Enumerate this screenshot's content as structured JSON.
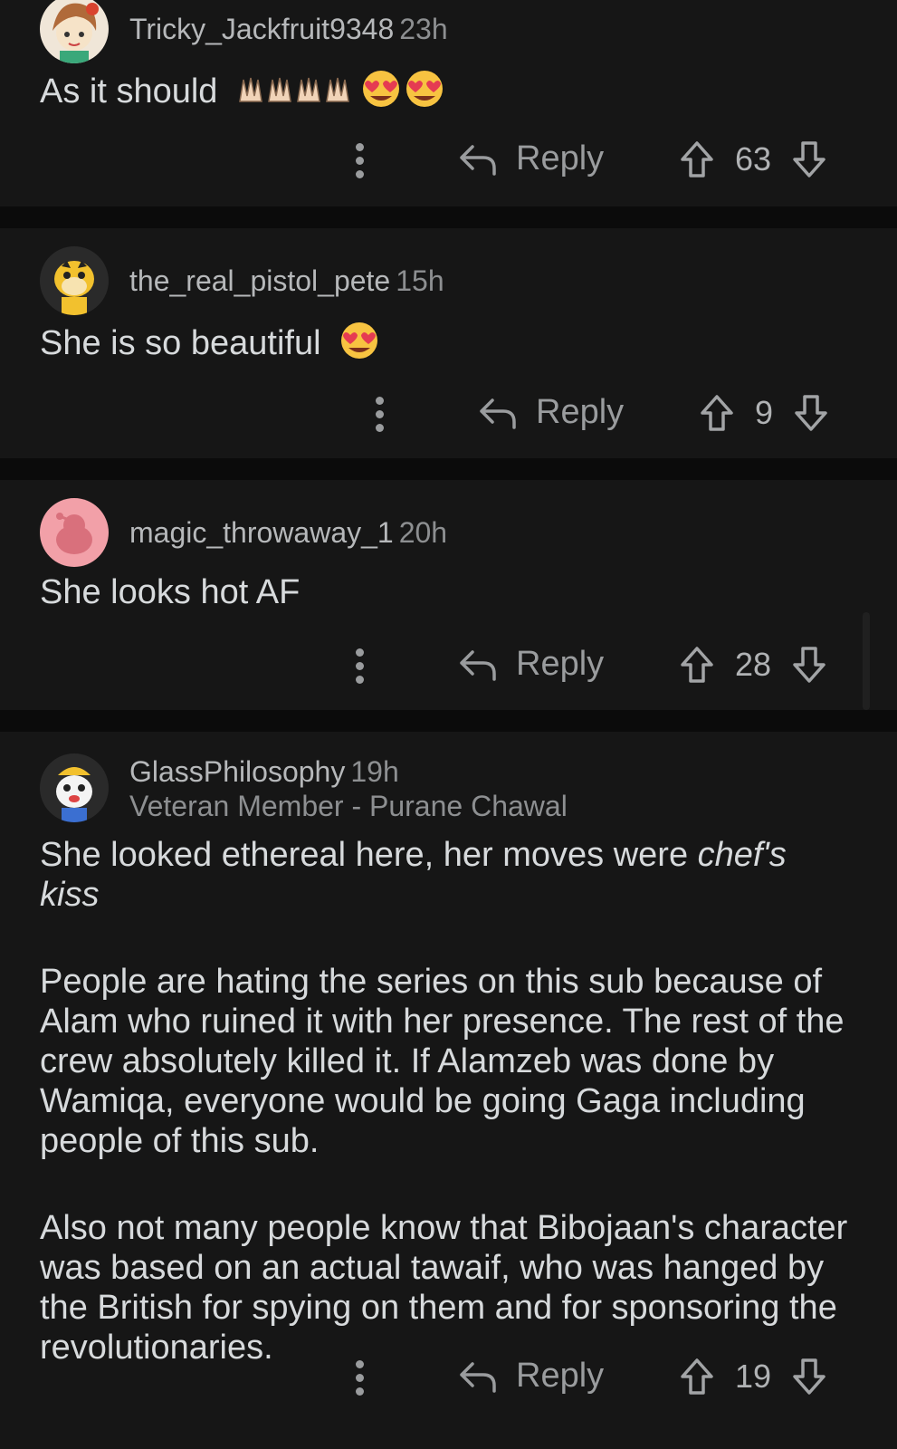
{
  "comments": [
    {
      "username": "Tricky_Jackfruit9348",
      "time": "23h",
      "text": "As it should",
      "emoji_icons": [
        "raised-hands-icon",
        "raised-hands-icon",
        "raised-hands-icon",
        "heart-eyes-icon",
        "heart-eyes-icon"
      ],
      "reply_label": "Reply",
      "score": "63"
    },
    {
      "username": "the_real_pistol_pete",
      "time": "15h",
      "text": "She is so beautiful",
      "emoji_icons": [
        "heart-eyes-icon"
      ],
      "reply_label": "Reply",
      "score": "9"
    },
    {
      "username": "magic_throwaway_1",
      "time": "20h",
      "text": "She looks hot AF",
      "reply_label": "Reply",
      "score": "28"
    },
    {
      "username": "GlassPhilosophy",
      "time": "19h",
      "flair": "Veteran Member - Purane Chawal",
      "paragraphs": [
        "She looked ethereal here, her moves were",
        "chef's kiss",
        "People are hating the series on this sub because of Alam who ruined it with her presence. The rest of the crew absolutely killed it. If Alamzeb was done by Wamiqa, everyone would be going Gaga including people of this sub.",
        "Also not many people know that Bibojaan's character was based on an actual tawaif, who was hanged by the British for spying on them and for sponsoring the revolutionaries."
      ],
      "reply_label": "Reply",
      "score": "19"
    }
  ],
  "colors": {
    "background": "#0b0b0b",
    "card": "#161616",
    "text": "#d7dadc",
    "muted": "#9a9c9e"
  }
}
